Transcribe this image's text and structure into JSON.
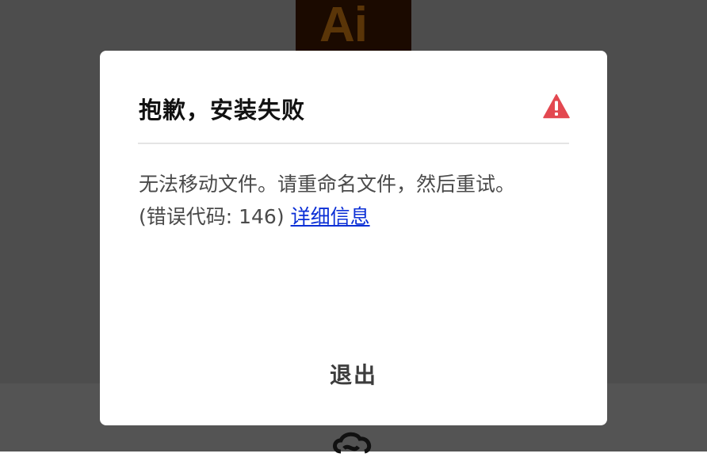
{
  "background": {
    "app_icon_text": "Ai",
    "app_icon": "adobe-illustrator-icon",
    "footer_logo": "creative-cloud-icon"
  },
  "dialog": {
    "title": "抱歉，安装失败",
    "icon": "warning-icon",
    "message": "无法移动文件。请重命名文件，然后重试。(错误代码: 146)",
    "details_link": "详细信息",
    "quit_button": "退出"
  },
  "colors": {
    "backdrop": "#4d4d4d",
    "dialog_bg": "#ffffff",
    "warning": "#e34850",
    "link": "#0b2fd6"
  }
}
